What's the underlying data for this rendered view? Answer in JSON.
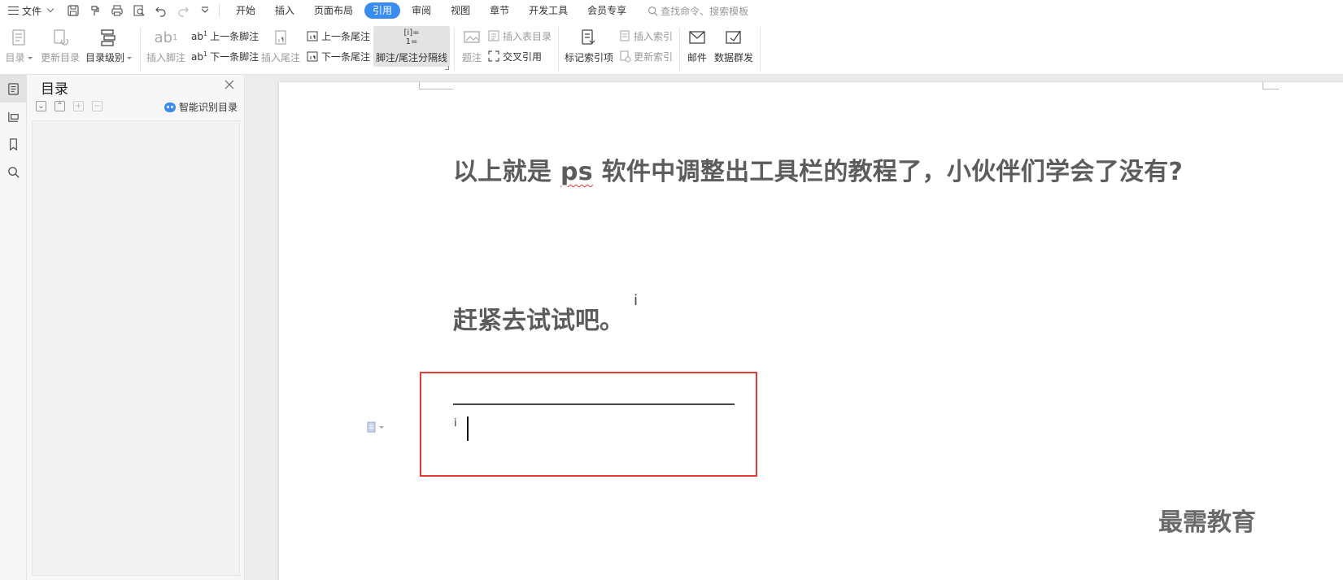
{
  "menubar": {
    "file_label": "文件",
    "tabs": [
      {
        "label": "开始"
      },
      {
        "label": "插入"
      },
      {
        "label": "页面布局"
      },
      {
        "label": "引用",
        "active": true
      },
      {
        "label": "审阅"
      },
      {
        "label": "视图"
      },
      {
        "label": "章节"
      },
      {
        "label": "开发工具"
      },
      {
        "label": "会员专享"
      }
    ],
    "search_placeholder": "查找命令、搜索模板",
    "active_tab_color": "#3b8cf0"
  },
  "ribbon": {
    "toc": "目录",
    "update_toc": "更新目录",
    "toc_level": "目录级别",
    "insert_footnote": "插入脚注",
    "prev_footnote": "上一条脚注",
    "next_footnote": "下一条脚注",
    "insert_endnote": "插入尾注",
    "prev_endnote": "上一条尾注",
    "next_endnote": "下一条尾注",
    "separator_line": "脚注/尾注分隔线",
    "caption": "题注",
    "insert_table_toc": "插入表目录",
    "cross_ref": "交叉引用",
    "mark_index": "标记索引项",
    "insert_index": "插入索引",
    "update_index": "更新索引",
    "mail": "邮件",
    "data_send": "数据群发"
  },
  "toc_panel": {
    "title": "目录",
    "ai_label": "智能识别目录"
  },
  "document": {
    "para1_before": "以上就是 ",
    "para1_misspelled": "ps",
    "para1_after": " 软件中调整出工具栏的教程了，小伙伴们学会了没有?",
    "para2": "赶紧去试试吧。",
    "endnote_ref": "i",
    "endnote_mark": "i",
    "watermark": "最需教育"
  },
  "colors": {
    "highlight_box": "#e53935",
    "text": "#5c5c5c"
  }
}
